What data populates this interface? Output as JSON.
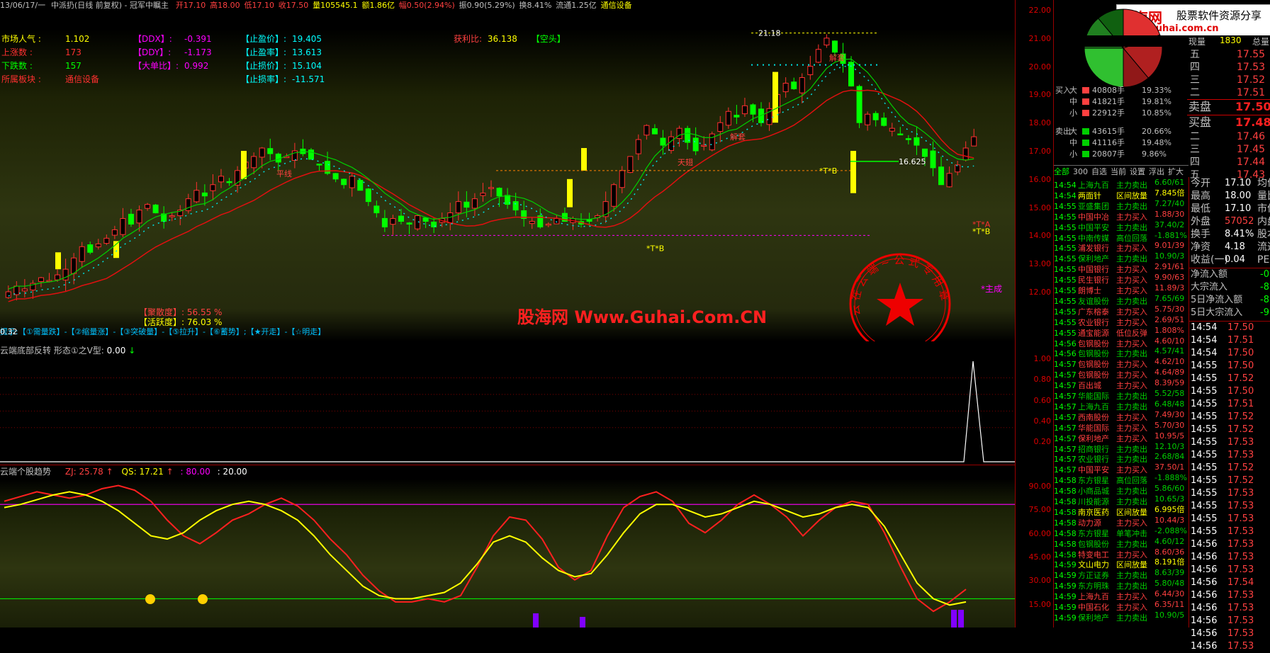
{
  "topbar": {
    "period": "13/06/17/一",
    "title": "中派扔(日线 前复权) - 冠军中瞩主",
    "open": "开17.10",
    "high": "高18.00",
    "low": "低17.10",
    "close": "收17.50",
    "volume": "量105545.1",
    "amount": "额1.86亿",
    "change": "幅0.50(2.94%)",
    "amplitude": "振0.90(5.29%)",
    "turnover": "换8.41%",
    "float": "流通1.25亿",
    "sector": "通信设备"
  },
  "left_stats": [
    {
      "label": "市场人气 :",
      "value": "1.102",
      "color": "#ffff00"
    },
    {
      "label": "上涨数 :",
      "value": "173",
      "color": "#ff3030"
    },
    {
      "label": "下跌数 :",
      "value": "157",
      "color": "#00ff00"
    },
    {
      "label": "所属板块 :",
      "value": "通信设备",
      "color": "#ff3030"
    }
  ],
  "mid_stats": [
    {
      "label": "【DDX】:",
      "value": "-0.391"
    },
    {
      "label": "【DDY】:",
      "value": "-1.173"
    },
    {
      "label": "【大单比】:",
      "value": "0.992"
    }
  ],
  "right_stats": [
    {
      "label": "【止盈价】:",
      "value": "19.405"
    },
    {
      "label": "【止盈率】:",
      "value": "13.613"
    },
    {
      "label": "【止损价】:",
      "value": "15.104"
    },
    {
      "label": "【止损率】:",
      "value": "-11.571"
    }
  ],
  "profit_ratio": {
    "label": "获利比:",
    "value": "36.138",
    "tag": "【空头】"
  },
  "main_annotations": {
    "peak_label": "21.18",
    "last_price_label": "16.625",
    "tb1": "*T*B",
    "tb2": "*T*B",
    "ta": "*T*A",
    "tb3": "*T*B",
    "main_label": "*主成",
    "zhulijiaru": "【聚散度】: 56.55 %",
    "huoyuedu": "【活跃度】: 76.03 %",
    "hint_line": "提示:【①需量跌】-【②缩量涨】-【③突破量】-【⑤拉升】-【⑥蓄势】;【★开走】-【☆明走】",
    "volume_value": "0.32",
    "jiedi1": "解套",
    "jiedi2": "解套",
    "jiedi3": "天翅",
    "jiedi4": "平线"
  },
  "watermark": "股海网 Www.Guhai.Com.CN",
  "seal_text": "云 在 云 端 ~ 公 式 专 用 章",
  "indicator1": {
    "title": "云端底部反转 形态①之V型:",
    "value": "0.00"
  },
  "indicator2": {
    "title": "云端个股趋势",
    "zj": "ZJ: 25.78",
    "qs": "QS: 17.21",
    "l1": ": 80.00",
    "l2": ": 20.00"
  },
  "price_ticks": [
    "22.00",
    "21.00",
    "20.00",
    "19.00",
    "18.00",
    "17.00",
    "16.00",
    "15.00",
    "14.00",
    "13.00",
    "12.00"
  ],
  "ind1_ticks": [
    "1.00",
    "0.80",
    "0.60",
    "0.40",
    "0.20"
  ],
  "ind2_ticks": [
    "90.00",
    "75.00",
    "60.00",
    "45.00",
    "30.00",
    "15.00"
  ],
  "right_panel": {
    "logo_title": "股海网",
    "logo_slogan": "股票软件资源分享",
    "logo_url": "www.Guhai.com.cn",
    "header_labels": [
      "现量",
      "总量"
    ],
    "vol_current": "1830",
    "buy_sell": [
      {
        "side": "卖盘",
        "price": "17.50",
        "big": true
      },
      {
        "side": "买盘",
        "price": "17.48",
        "big": true
      }
    ],
    "ask_levels": [
      {
        "lvl": "五",
        "price": "17.55"
      },
      {
        "lvl": "四",
        "price": "17.53"
      },
      {
        "lvl": "三",
        "price": "17.52"
      },
      {
        "lvl": "二",
        "price": "17.51"
      }
    ],
    "bid_levels": [
      {
        "lvl": "二",
        "price": "17.46"
      },
      {
        "lvl": "三",
        "price": "17.45"
      },
      {
        "lvl": "四",
        "price": "17.44"
      },
      {
        "lvl": "五",
        "price": "17.43"
      }
    ],
    "order_flow": [
      {
        "side": "买入",
        "size": "大",
        "vol": "40808手",
        "pct": "19.33%",
        "color": "#ff4040"
      },
      {
        "side": "",
        "size": "中",
        "vol": "41821手",
        "pct": "19.81%",
        "color": "#ff4040"
      },
      {
        "side": "",
        "size": "小",
        "vol": "22912手",
        "pct": "10.85%",
        "color": "#ff4040"
      },
      {
        "side": "卖出",
        "size": "大",
        "vol": "43615手",
        "pct": "20.66%",
        "color": "#00d000"
      },
      {
        "side": "",
        "size": "中",
        "vol": "41116手",
        "pct": "19.48%",
        "color": "#00d000"
      },
      {
        "side": "",
        "size": "小",
        "vol": "20807手",
        "pct": "9.86%",
        "color": "#00d000"
      }
    ],
    "tabs": [
      "全部",
      "300",
      "自选",
      "当前",
      "设置",
      "浮出",
      "扩大"
    ],
    "stats": [
      {
        "label": "今开",
        "value": "17.10",
        "label2": "均价"
      },
      {
        "label": "最高",
        "value": "18.00",
        "label2": "量比"
      },
      {
        "label": "最低",
        "value": "17.10",
        "label2": "市价"
      },
      {
        "label": "外盘",
        "value": "57052",
        "label2": "内盘"
      },
      {
        "label": "换手",
        "value": "8.41%",
        "label2": "股本"
      },
      {
        "label": "净资",
        "value": "4.18",
        "label2": "流通"
      },
      {
        "label": "收益(一)",
        "value": "0.04",
        "label2": "PE"
      }
    ],
    "flows": [
      {
        "label": "净流入额",
        "value": "-0"
      },
      {
        "label": "大宗流入",
        "value": "-8"
      },
      {
        "label": "5日净流入额",
        "value": "-8"
      },
      {
        "label": "5日大宗流入",
        "value": "-9"
      }
    ],
    "ticks": [
      {
        "t": "14:54",
        "p": "17.50",
        "c": "#ff4040"
      },
      {
        "t": "14:54",
        "p": "17.51",
        "c": "#ff4040"
      },
      {
        "t": "14:54",
        "p": "17.50",
        "c": "#ff4040"
      },
      {
        "t": "14:55",
        "p": "17.50",
        "c": "#ff4040"
      },
      {
        "t": "14:55",
        "p": "17.52",
        "c": "#ff4040"
      },
      {
        "t": "14:55",
        "p": "17.50",
        "c": "#ff4040"
      },
      {
        "t": "14:55",
        "p": "17.51",
        "c": "#ff4040"
      },
      {
        "t": "14:55",
        "p": "17.52",
        "c": "#ff4040"
      },
      {
        "t": "14:55",
        "p": "17.52",
        "c": "#ff4040"
      },
      {
        "t": "14:55",
        "p": "17.53",
        "c": "#ff4040"
      },
      {
        "t": "14:55",
        "p": "17.53",
        "c": "#ff4040"
      },
      {
        "t": "14:55",
        "p": "17.52",
        "c": "#ff4040"
      },
      {
        "t": "14:55",
        "p": "17.52",
        "c": "#ff4040"
      },
      {
        "t": "14:55",
        "p": "17.53",
        "c": "#ff4040"
      },
      {
        "t": "14:55",
        "p": "17.53",
        "c": "#ff4040"
      },
      {
        "t": "14:55",
        "p": "17.53",
        "c": "#ff4040"
      },
      {
        "t": "14:55",
        "p": "17.53",
        "c": "#ff4040"
      },
      {
        "t": "14:56",
        "p": "17.53",
        "c": "#ff4040"
      },
      {
        "t": "14:56",
        "p": "17.53",
        "c": "#ff4040"
      },
      {
        "t": "14:56",
        "p": "17.53",
        "c": "#ff4040"
      },
      {
        "t": "14:56",
        "p": "17.54",
        "c": "#ff4040"
      },
      {
        "t": "14:56",
        "p": "17.53",
        "c": "#ff4040"
      },
      {
        "t": "14:56",
        "p": "17.53",
        "c": "#ff4040"
      },
      {
        "t": "14:56",
        "p": "17.53",
        "c": "#ff4040"
      },
      {
        "t": "14:56",
        "p": "17.53",
        "c": "#ff4040"
      },
      {
        "t": "14:56",
        "p": "17.53",
        "c": "#ff4040"
      }
    ],
    "market_feed": [
      {
        "t": "14:54",
        "n": "上海九百",
        "a": "主力卖出",
        "v": "6.60/61",
        "c": "#00d000"
      },
      {
        "t": "14:54",
        "n": "两面针",
        "a": "区间放量",
        "v": "7.845倍",
        "c": "#ffff00"
      },
      {
        "t": "14:55",
        "n": "亚盛集团",
        "a": "主力卖出",
        "v": "7.27/40",
        "c": "#00d000"
      },
      {
        "t": "14:55",
        "n": "中国中冶",
        "a": "主力买入",
        "v": "1.88/30",
        "c": "#ff4040"
      },
      {
        "t": "14:55",
        "n": "中国平安",
        "a": "主力卖出",
        "v": "37.40/2",
        "c": "#00d000"
      },
      {
        "t": "14:55",
        "n": "中南传媒",
        "a": "高位回落",
        "v": "-1.881%",
        "c": "#00d000"
      },
      {
        "t": "14:55",
        "n": "浦发银行",
        "a": "主力买入",
        "v": "9.01/39",
        "c": "#ff4040"
      },
      {
        "t": "14:55",
        "n": "保利地产",
        "a": "主力卖出",
        "v": "10.90/3",
        "c": "#00d000"
      },
      {
        "t": "14:55",
        "n": "中国银行",
        "a": "主力买入",
        "v": "2.91/61",
        "c": "#ff4040"
      },
      {
        "t": "14:55",
        "n": "民生银行",
        "a": "主力买入",
        "v": "9.90/63",
        "c": "#ff4040"
      },
      {
        "t": "14:55",
        "n": "朗博士",
        "a": "主力买入",
        "v": "11.89/3",
        "c": "#ff4040"
      },
      {
        "t": "14:55",
        "n": "友谊股份",
        "a": "主力卖出",
        "v": "7.65/69",
        "c": "#00d000"
      },
      {
        "t": "14:55",
        "n": "广东榕泰",
        "a": "主力买入",
        "v": "5.75/30",
        "c": "#ff4040"
      },
      {
        "t": "14:55",
        "n": "农业银行",
        "a": "主力买入",
        "v": "2.69/51",
        "c": "#ff4040"
      },
      {
        "t": "14:55",
        "n": "通宝能源",
        "a": "低位反弹",
        "v": "1.808%",
        "c": "#ff4040"
      },
      {
        "t": "14:56",
        "n": "包钢股份",
        "a": "主力买入",
        "v": "4.60/10",
        "c": "#ff4040"
      },
      {
        "t": "14:56",
        "n": "包钢股份",
        "a": "主力卖出",
        "v": "4.57/41",
        "c": "#00d000"
      },
      {
        "t": "14:57",
        "n": "包钢股份",
        "a": "主力买入",
        "v": "4.62/10",
        "c": "#ff4040"
      },
      {
        "t": "14:57",
        "n": "包钢股份",
        "a": "主力买入",
        "v": "4.64/89",
        "c": "#ff4040"
      },
      {
        "t": "14:57",
        "n": "百出城",
        "a": "主力买入",
        "v": "8.39/59",
        "c": "#ff4040"
      },
      {
        "t": "14:57",
        "n": "华能国际",
        "a": "主力卖出",
        "v": "5.52/58",
        "c": "#00d000"
      },
      {
        "t": "14:57",
        "n": "上海九百",
        "a": "主力卖出",
        "v": "6.48/48",
        "c": "#00d000"
      },
      {
        "t": "14:57",
        "n": "西南股份",
        "a": "主力买入",
        "v": "7.49/30",
        "c": "#ff4040"
      },
      {
        "t": "14:57",
        "n": "华能国际",
        "a": "主力买入",
        "v": "5.70/30",
        "c": "#ff4040"
      },
      {
        "t": "14:57",
        "n": "保利地产",
        "a": "主力买入",
        "v": "10.95/5",
        "c": "#ff4040"
      },
      {
        "t": "14:57",
        "n": "招商银行",
        "a": "主力卖出",
        "v": "12.10/3",
        "c": "#00d000"
      },
      {
        "t": "14:57",
        "n": "农业银行",
        "a": "主力卖出",
        "v": "2.68/84",
        "c": "#00d000"
      },
      {
        "t": "14:57",
        "n": "中国平安",
        "a": "主力买入",
        "v": "37.50/1",
        "c": "#ff4040"
      },
      {
        "t": "14:58",
        "n": "东方银星",
        "a": "高位回落",
        "v": "-1.888%",
        "c": "#00d000"
      },
      {
        "t": "14:58",
        "n": "小商品城",
        "a": "主力卖出",
        "v": "5.86/60",
        "c": "#00d000"
      },
      {
        "t": "14:58",
        "n": "川投能源",
        "a": "主力卖出",
        "v": "10.65/3",
        "c": "#00d000"
      },
      {
        "t": "14:58",
        "n": "南京医药",
        "a": "区间放量",
        "v": "6.995倍",
        "c": "#ffff00"
      },
      {
        "t": "14:58",
        "n": "动力源",
        "a": "主力买入",
        "v": "10.44/3",
        "c": "#ff4040"
      },
      {
        "t": "14:58",
        "n": "东方银星",
        "a": "单笔冲击",
        "v": "-2.088%",
        "c": "#00d000"
      },
      {
        "t": "14:58",
        "n": "包钢股份",
        "a": "主力卖出",
        "v": "4.60/12",
        "c": "#00d000"
      },
      {
        "t": "14:58",
        "n": "特变电工",
        "a": "主力买入",
        "v": "8.60/36",
        "c": "#ff4040"
      },
      {
        "t": "14:59",
        "n": "文山电力",
        "a": "区间放量",
        "v": "8.191倍",
        "c": "#ffff00"
      },
      {
        "t": "14:59",
        "n": "方正证券",
        "a": "主力卖出",
        "v": "8.63/39",
        "c": "#00d000"
      },
      {
        "t": "14:59",
        "n": "东方明珠",
        "a": "主力卖出",
        "v": "5.80/48",
        "c": "#00d000"
      },
      {
        "t": "14:59",
        "n": "上海九百",
        "a": "主力买入",
        "v": "6.44/30",
        "c": "#ff4040"
      },
      {
        "t": "14:59",
        "n": "中国石化",
        "a": "主力买入",
        "v": "6.35/11",
        "c": "#ff4040"
      },
      {
        "t": "14:59",
        "n": "保利地产",
        "a": "主力卖出",
        "v": "10.90/5",
        "c": "#00d000"
      }
    ]
  },
  "colors": {
    "up": "#ff3030",
    "down": "#00ffff",
    "yellow": "#ffff00",
    "green": "#00ff00",
    "magenta": "#ff00ff",
    "axis": "#c00000"
  }
}
